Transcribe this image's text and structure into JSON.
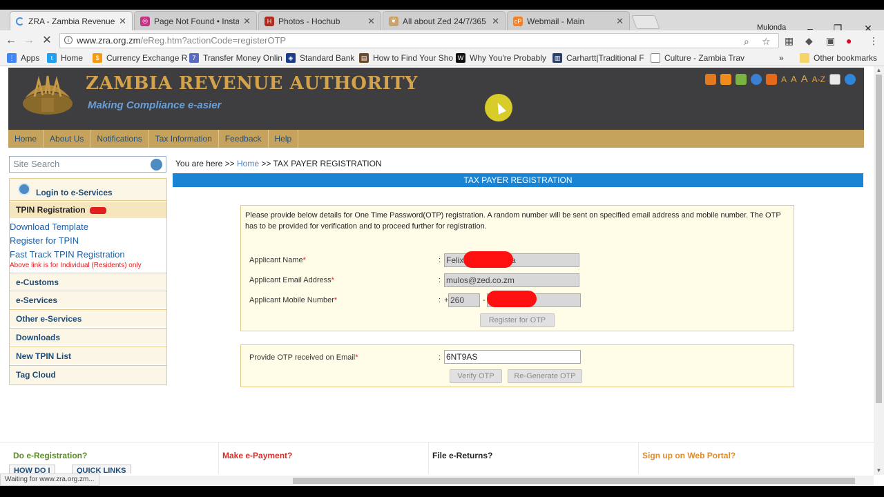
{
  "browser": {
    "tabs": [
      {
        "label": "ZRA - Zambia Revenue A",
        "icon": "loading-icon",
        "active": true
      },
      {
        "label": "Page Not Found • Instag",
        "icon": "instagram-icon",
        "active": false
      },
      {
        "label": "Photos - Hochub",
        "icon": "hochub-icon",
        "active": false
      },
      {
        "label": "All about Zed 24/7/365",
        "icon": "bookmark-ribbon-icon",
        "active": false
      },
      {
        "label": "Webmail - Main",
        "icon": "cpanel-icon",
        "active": false
      }
    ],
    "profile_name": "Mulonda",
    "url_domain": "www.zra.org.zm",
    "url_path": "/eReg.htm?actionCode=registerOTP",
    "bookmarks": [
      "Apps",
      "Home",
      "Currency Exchange R",
      "Transfer Money Onlin",
      "Standard Bank",
      "How to Find Your Sho",
      "Why You're Probably",
      "Carhartt|Traditional F",
      "Culture - Zambia Trav"
    ],
    "other_bookmarks": "Other bookmarks",
    "status_text": "Waiting for www.zra.org.zm..."
  },
  "site": {
    "title": "ZAMBIA REVENUE AUTHORITY",
    "tagline": "Making Compliance e-asier",
    "header_tools_text": [
      "A",
      "A",
      "A",
      "A-Z"
    ],
    "nav": [
      "Home",
      "About Us",
      "Notifications",
      "Tax Information",
      "Feedback",
      "Help"
    ],
    "search_placeholder": "Site Search",
    "colors": {
      "header_bg": "#3e3e40",
      "nav_bg": "#c6a35c",
      "gold": "#d4a24a",
      "section_blue": "#1a84d4"
    }
  },
  "sidebar": {
    "login": "Login to  e-Services",
    "tpin_registration": "TPIN Registration",
    "links": [
      "Download Template",
      "Register for TPIN",
      "Fast Track TPIN Registration"
    ],
    "note": "Above link is for Individual (Residents) only",
    "items": [
      "e-Customs",
      "e-Services",
      "Other e-Services",
      "Downloads",
      "New TPIN List",
      "Tag Cloud"
    ]
  },
  "content": {
    "breadcrumb_prefix": "You are here >>",
    "breadcrumb_home": "Home",
    "breadcrumb_current": ">> TAX PAYER REGISTRATION",
    "section_title": "TAX PAYER REGISTRATION",
    "intro": "Please provide below details for One Time Password(OTP) registration. A random number will be sent on specified email address and mobile number. The OTP has to be provided for verification and to proceed further for registration.",
    "fields": {
      "name_label": "Applicant Name",
      "name_value": "Felix",
      "name_value_tail": "a",
      "email_label": "Applicant Email Address",
      "email_value": "mulos@zed.co.zm",
      "mobile_label": "Applicant Mobile Number",
      "mobile_prefix_plus": "+",
      "mobile_code": "260",
      "mobile_dash": "-"
    },
    "register_otp_button": "Register for OTP",
    "otp_label": "Provide OTP received on Email",
    "otp_value": "6NT9AS",
    "verify_button": "Verify OTP",
    "regenerate_button": "Re-Generate OTP",
    "required_mark": "*",
    "colon": ":"
  },
  "footer_links": {
    "e_registration": "Do e-Registration?",
    "e_payment": "Make e-Payment?",
    "e_returns": "File e-Returns?",
    "web_portal": "Sign up on Web Portal?",
    "how_do_i": "HOW DO I",
    "quick_links": "QUICK LINKS"
  }
}
